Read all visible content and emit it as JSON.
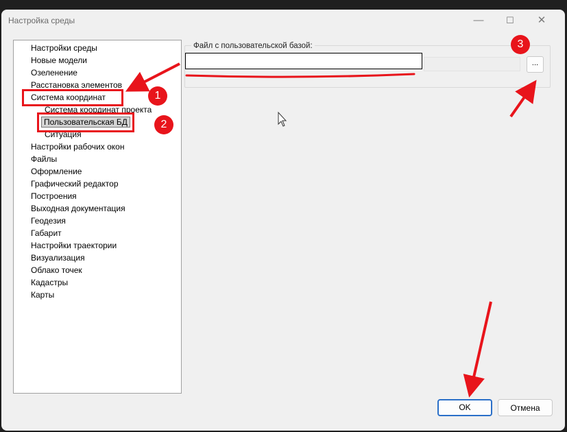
{
  "window": {
    "title": "Настройка среды",
    "controls": {
      "minimize": "—",
      "maximize": "☐",
      "close": "✕"
    }
  },
  "tree": {
    "items": [
      {
        "label": "Настройки среды"
      },
      {
        "label": "Новые модели"
      },
      {
        "label": "Озеленение"
      },
      {
        "label": "Расстановка элементов"
      },
      {
        "label": "Система координат"
      },
      {
        "label": "Система координат проекта"
      },
      {
        "label": "Пользовательская БД"
      },
      {
        "label": "Ситуация"
      },
      {
        "label": "Настройки рабочих окон"
      },
      {
        "label": "Файлы"
      },
      {
        "label": "Оформление"
      },
      {
        "label": "Графический редактор"
      },
      {
        "label": "Построения"
      },
      {
        "label": "Выходная документация"
      },
      {
        "label": "Геодезия"
      },
      {
        "label": "Габарит"
      },
      {
        "label": "Настройки траектории"
      },
      {
        "label": "Визуализация"
      },
      {
        "label": "Облако точек"
      },
      {
        "label": "Кадастры"
      },
      {
        "label": "Карты"
      }
    ]
  },
  "panel": {
    "group_label": "Файл с пользовательской базой:",
    "file_value": "",
    "browse_label": "..."
  },
  "buttons": {
    "ok": "OK",
    "cancel": "Отмена"
  },
  "annotations": {
    "badges": [
      "1",
      "2",
      "3"
    ],
    "color": "#e8141b"
  }
}
